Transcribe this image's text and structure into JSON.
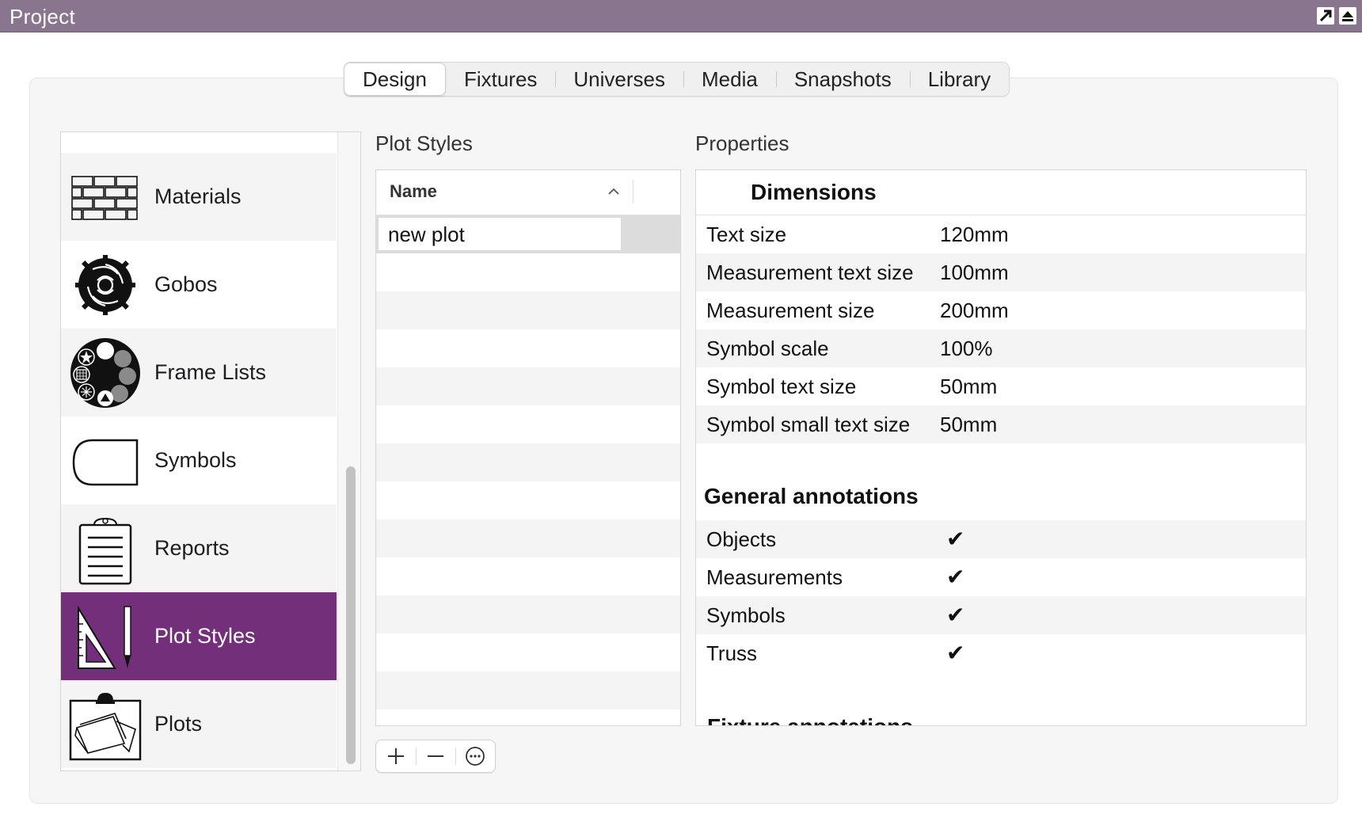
{
  "window": {
    "title": "Project"
  },
  "tabs": [
    {
      "label": "Design",
      "active": true
    },
    {
      "label": "Fixtures"
    },
    {
      "label": "Universes"
    },
    {
      "label": "Media"
    },
    {
      "label": "Snapshots"
    },
    {
      "label": "Library"
    }
  ],
  "sidebar": {
    "items": [
      {
        "label": "Materials",
        "icon": "materials-icon"
      },
      {
        "label": "Gobos",
        "icon": "gobo-icon"
      },
      {
        "label": "Frame Lists",
        "icon": "frame-list-icon"
      },
      {
        "label": "Symbols",
        "icon": "symbol-icon"
      },
      {
        "label": "Reports",
        "icon": "clipboard-icon"
      },
      {
        "label": "Plot Styles",
        "icon": "set-square-pencil-icon",
        "selected": true
      },
      {
        "label": "Plots",
        "icon": "plot-icon"
      }
    ]
  },
  "plot_styles": {
    "header": "Plot Styles",
    "column_name": "Name",
    "rows": [
      "new plot"
    ]
  },
  "properties": {
    "header": "Properties",
    "dimensions": {
      "title": "Dimensions",
      "rows": [
        {
          "key": "Text size",
          "value": "120mm"
        },
        {
          "key": "Measurement text size",
          "value": "100mm"
        },
        {
          "key": "Measurement size",
          "value": "200mm"
        },
        {
          "key": "Symbol scale",
          "value": "100%"
        },
        {
          "key": "Symbol text size",
          "value": "50mm"
        },
        {
          "key": "Symbol small text size",
          "value": "50mm"
        }
      ]
    },
    "general": {
      "title": "General annotations",
      "rows": [
        {
          "key": "Objects",
          "checked": "✔"
        },
        {
          "key": "Measurements",
          "checked": "✔"
        },
        {
          "key": "Symbols",
          "checked": "✔"
        },
        {
          "key": "Truss",
          "checked": "✔"
        }
      ]
    },
    "fixture": {
      "title": "Fixture annotations"
    }
  },
  "colors": {
    "titlebar": "#8a758f",
    "selection": "#732f7a"
  }
}
